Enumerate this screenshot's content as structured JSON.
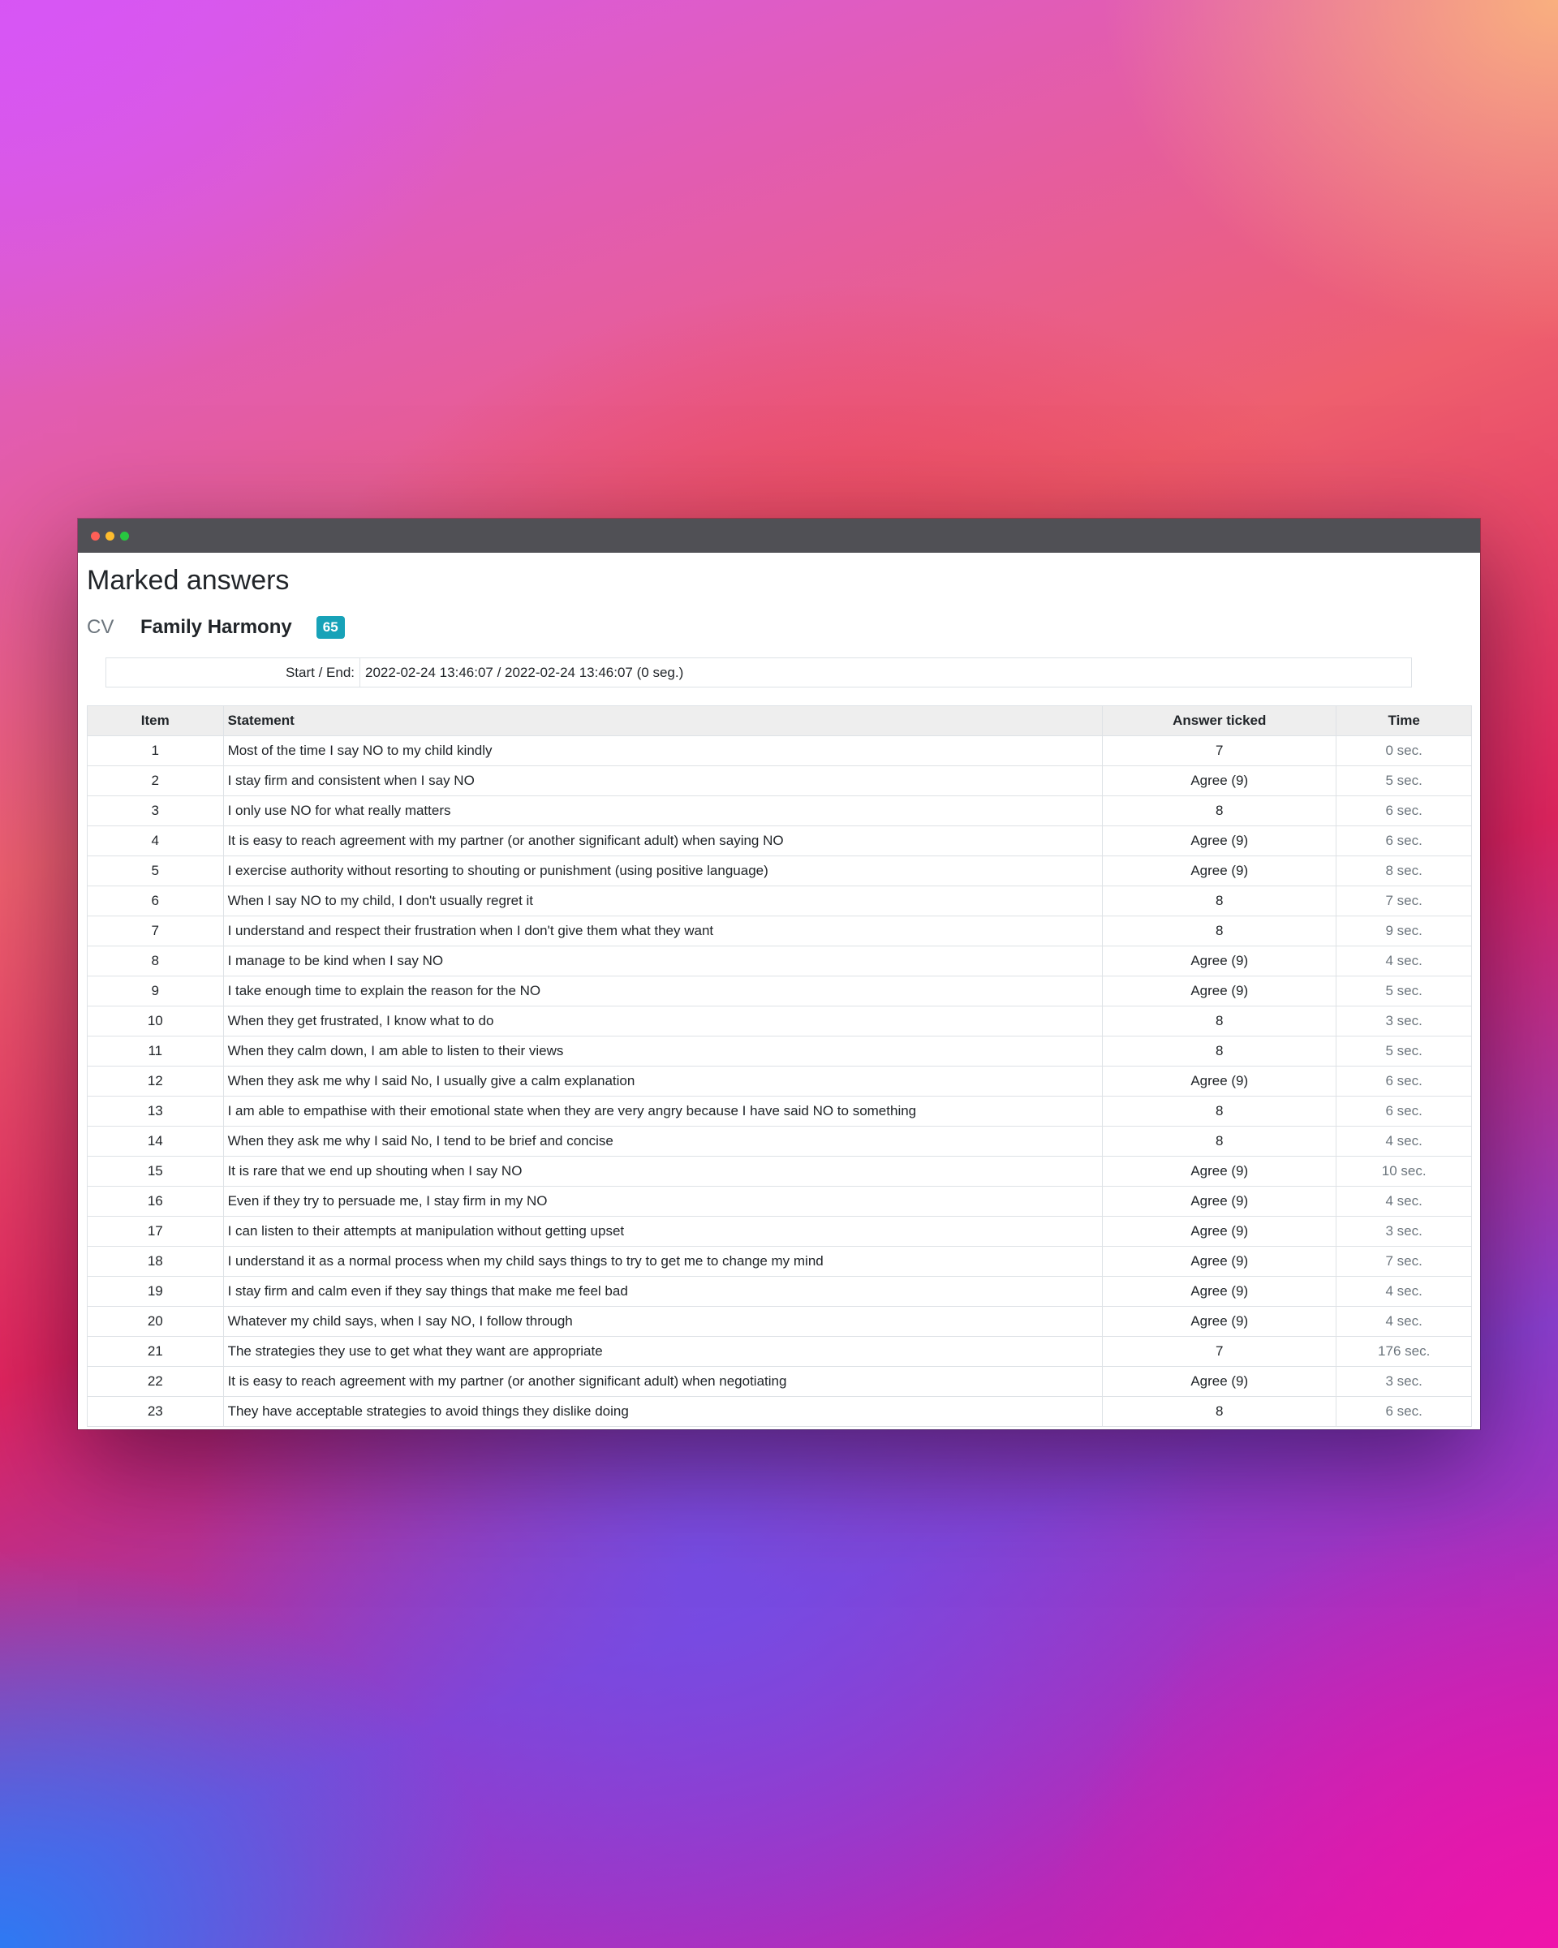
{
  "page": {
    "title": "Marked answers",
    "test_code": "CV",
    "test_name": "Family Harmony",
    "score": "65"
  },
  "meta": {
    "start_end_label": "Start / End:",
    "start_end_value": "2022-02-24 13:46:07 / 2022-02-24 13:46:07 (0 seg.)"
  },
  "table": {
    "headers": {
      "item": "Item",
      "statement": "Statement",
      "answer": "Answer ticked",
      "time": "Time"
    },
    "rows": [
      {
        "item": "1",
        "statement": "Most of the time I say NO to my child kindly",
        "answer": "7",
        "time": "0 sec."
      },
      {
        "item": "2",
        "statement": "I stay firm and consistent when I say NO",
        "answer": "Agree (9)",
        "time": "5 sec."
      },
      {
        "item": "3",
        "statement": "I only use NO for what really matters",
        "answer": "8",
        "time": "6 sec."
      },
      {
        "item": "4",
        "statement": "It is easy to reach agreement with my partner (or another significant adult) when saying NO",
        "answer": "Agree (9)",
        "time": "6 sec."
      },
      {
        "item": "5",
        "statement": "I exercise authority without resorting to shouting or punishment (using positive language)",
        "answer": "Agree (9)",
        "time": "8 sec."
      },
      {
        "item": "6",
        "statement": "When I say NO to my child, I don't usually regret it",
        "answer": "8",
        "time": "7 sec."
      },
      {
        "item": "7",
        "statement": "I understand and respect their frustration when I don't give them what they want",
        "answer": "8",
        "time": "9 sec."
      },
      {
        "item": "8",
        "statement": "I manage to be kind when I say NO",
        "answer": "Agree (9)",
        "time": "4 sec."
      },
      {
        "item": "9",
        "statement": "I take enough time to explain the reason for the NO",
        "answer": "Agree (9)",
        "time": "5 sec."
      },
      {
        "item": "10",
        "statement": "When they get frustrated, I know what to do",
        "answer": "8",
        "time": "3 sec."
      },
      {
        "item": "11",
        "statement": "When they calm down, I am able to listen to their views",
        "answer": "8",
        "time": "5 sec."
      },
      {
        "item": "12",
        "statement": "When they ask me why I said No, I usually give a calm explanation",
        "answer": "Agree (9)",
        "time": "6 sec."
      },
      {
        "item": "13",
        "statement": "I am able to empathise with their emotional state when they are very angry because I have said NO to something",
        "answer": "8",
        "time": "6 sec."
      },
      {
        "item": "14",
        "statement": "When they ask me why I said No, I tend to be brief and concise",
        "answer": "8",
        "time": "4 sec."
      },
      {
        "item": "15",
        "statement": "It is rare that we end up shouting when I say NO",
        "answer": "Agree (9)",
        "time": "10 sec."
      },
      {
        "item": "16",
        "statement": "Even if they try to persuade me, I stay firm in my NO",
        "answer": "Agree (9)",
        "time": "4 sec."
      },
      {
        "item": "17",
        "statement": "I can listen to their attempts at manipulation without getting upset",
        "answer": "Agree (9)",
        "time": "3 sec."
      },
      {
        "item": "18",
        "statement": "I understand it as a normal process when my child says things to try to get me to change my mind",
        "answer": "Agree (9)",
        "time": "7 sec."
      },
      {
        "item": "19",
        "statement": "I stay firm and calm even if they say things that make me feel bad",
        "answer": "Agree (9)",
        "time": "4 sec."
      },
      {
        "item": "20",
        "statement": "Whatever my child says, when I say NO, I follow through",
        "answer": "Agree (9)",
        "time": "4 sec."
      },
      {
        "item": "21",
        "statement": "The strategies they use to get what they want are appropriate",
        "answer": "7",
        "time": "176 sec."
      },
      {
        "item": "22",
        "statement": "It is easy to reach agreement with my partner (or another significant adult) when negotiating",
        "answer": "Agree (9)",
        "time": "3 sec."
      },
      {
        "item": "23",
        "statement": "They have acceptable strategies to avoid things they dislike doing",
        "answer": "8",
        "time": "6 sec."
      }
    ]
  },
  "colors": {
    "badge": "#17a2b8",
    "titlebar": "#505055",
    "header_bg": "#eeeeee"
  }
}
